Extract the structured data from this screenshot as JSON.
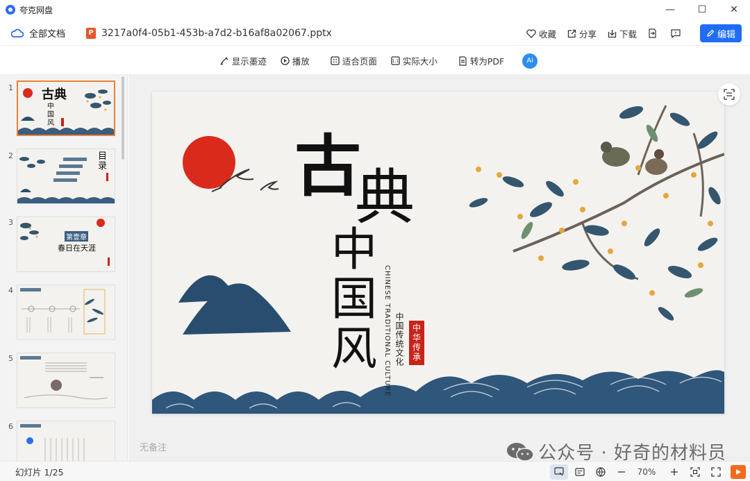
{
  "app": {
    "name": "夸克网盘"
  },
  "header": {
    "all_docs": "全部文档",
    "file_icon": "P",
    "file_name": "3217a0f4-05b1-453b-a7d2-b16af8a02067.pptx",
    "actions": {
      "favorite": "收藏",
      "share": "分享",
      "download": "下载"
    },
    "edit": "编辑"
  },
  "toolbar": {
    "ink": "显示墨迹",
    "play": "播放",
    "fit_page": "适合页面",
    "actual_size": "实际大小",
    "to_pdf": "转为PDF",
    "ai": "Ai"
  },
  "sidebar": {
    "slides": [
      {
        "num": "1",
        "title": "古典",
        "sub": "中国风"
      },
      {
        "num": "2",
        "title": "目录"
      },
      {
        "num": "3",
        "title": "第壹章",
        "sub": "春日在天涯"
      },
      {
        "num": "4"
      },
      {
        "num": "5"
      },
      {
        "num": "6"
      }
    ]
  },
  "slide": {
    "title_1": "古",
    "title_2": "典",
    "title_vertical": "中国风",
    "subtitle_en": "CHINESE TRADITIONAL CULTURE",
    "subtitle_cn": "中国传统文化",
    "seal": "中华传承"
  },
  "notes": {
    "placeholder": "无备注"
  },
  "watermark": {
    "text": "公众号 · 好奇的材料员"
  },
  "status": {
    "slide_count": "幻灯片 1/25",
    "zoom": "70%"
  },
  "colors": {
    "accent": "#1f6df5",
    "active_thumb_border": "#e8823a",
    "sun_red": "#d92a1c",
    "ink_blue": "#284d6e",
    "seal_red": "#c8241a",
    "play_orange": "#f26b1d"
  }
}
